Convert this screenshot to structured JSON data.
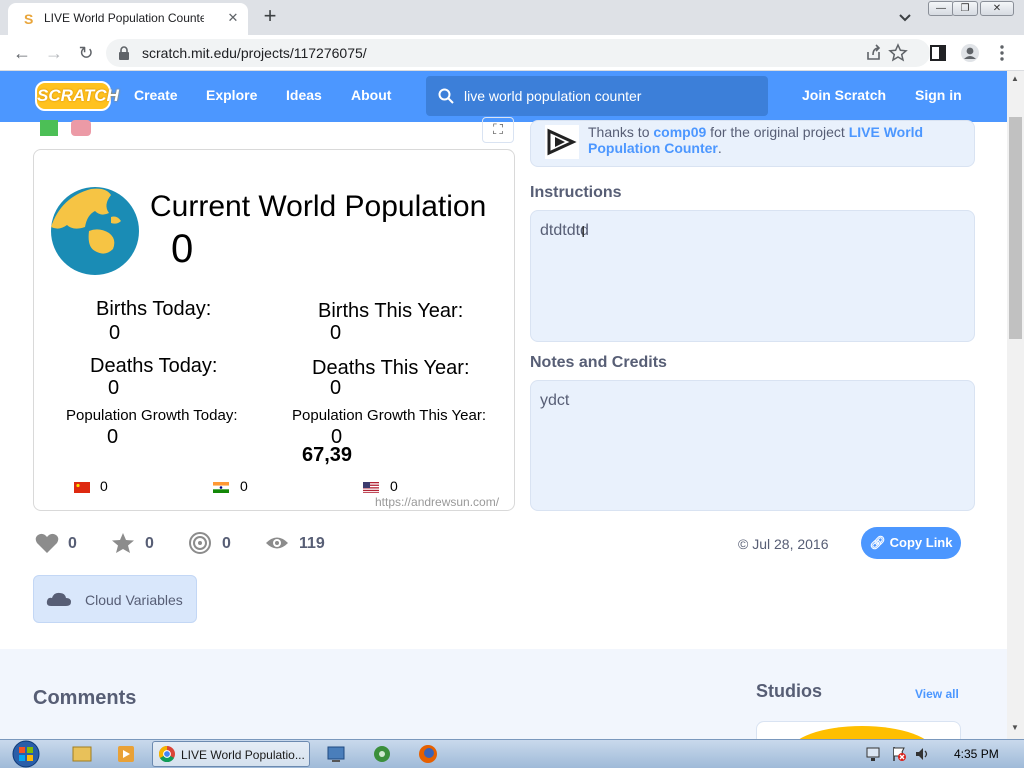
{
  "browser": {
    "tab_title": "LIVE World Population Counter o",
    "tab_close": "✕",
    "new_tab": "+",
    "url": "scratch.mit.edu/projects/117276075/",
    "window_buttons": [
      "—",
      "❐",
      "✕"
    ]
  },
  "navbar": {
    "logo": "SCRATCH",
    "links": [
      "Create",
      "Explore",
      "Ideas",
      "About"
    ],
    "search_value": "live world population counter",
    "join": "Join Scratch",
    "signin": "Sign in"
  },
  "stage": {
    "title": "Current World Population",
    "population": "0",
    "births_today_label": "Births Today:",
    "births_today_value": "0",
    "births_year_label": "Births This Year:",
    "births_year_value": "0",
    "deaths_today_label": "Deaths Today:",
    "deaths_today_value": "0",
    "deaths_year_label": "Deaths This Year:",
    "deaths_year_value": "0",
    "growth_today_label": "Population Growth Today:",
    "growth_today_value": "0",
    "growth_year_label": "Population Growth This Year:",
    "growth_year_value": "0",
    "overlay_number": "67,39",
    "country_counts": [
      "0",
      "0",
      "0"
    ],
    "source_url": "https://andrewsun.com/"
  },
  "remix": {
    "prefix": "Thanks to ",
    "author": "comp09",
    "middle": " for the original project ",
    "project": "LIVE World Population Counter",
    "suffix": "."
  },
  "instructions": {
    "heading": "Instructions",
    "text": "dtdtdtd"
  },
  "notes": {
    "heading": "Notes and Credits",
    "text": "ydct"
  },
  "stats": {
    "loves": "0",
    "favorites": "0",
    "remixes": "0",
    "views": "119"
  },
  "date": "© Jul 28, 2016",
  "copy_link": "Copy Link",
  "cloud_variables": "Cloud Variables",
  "comments_heading": "Comments",
  "studios_heading": "Studios",
  "view_all": "View all",
  "taskbar": {
    "chrome_label": "LIVE World Populatio...",
    "clock": "4:35 PM"
  },
  "colors": {
    "scratch_blue": "#4c97ff",
    "scratch_text": "#575e75",
    "logo_yellow": "#ffc21f"
  }
}
